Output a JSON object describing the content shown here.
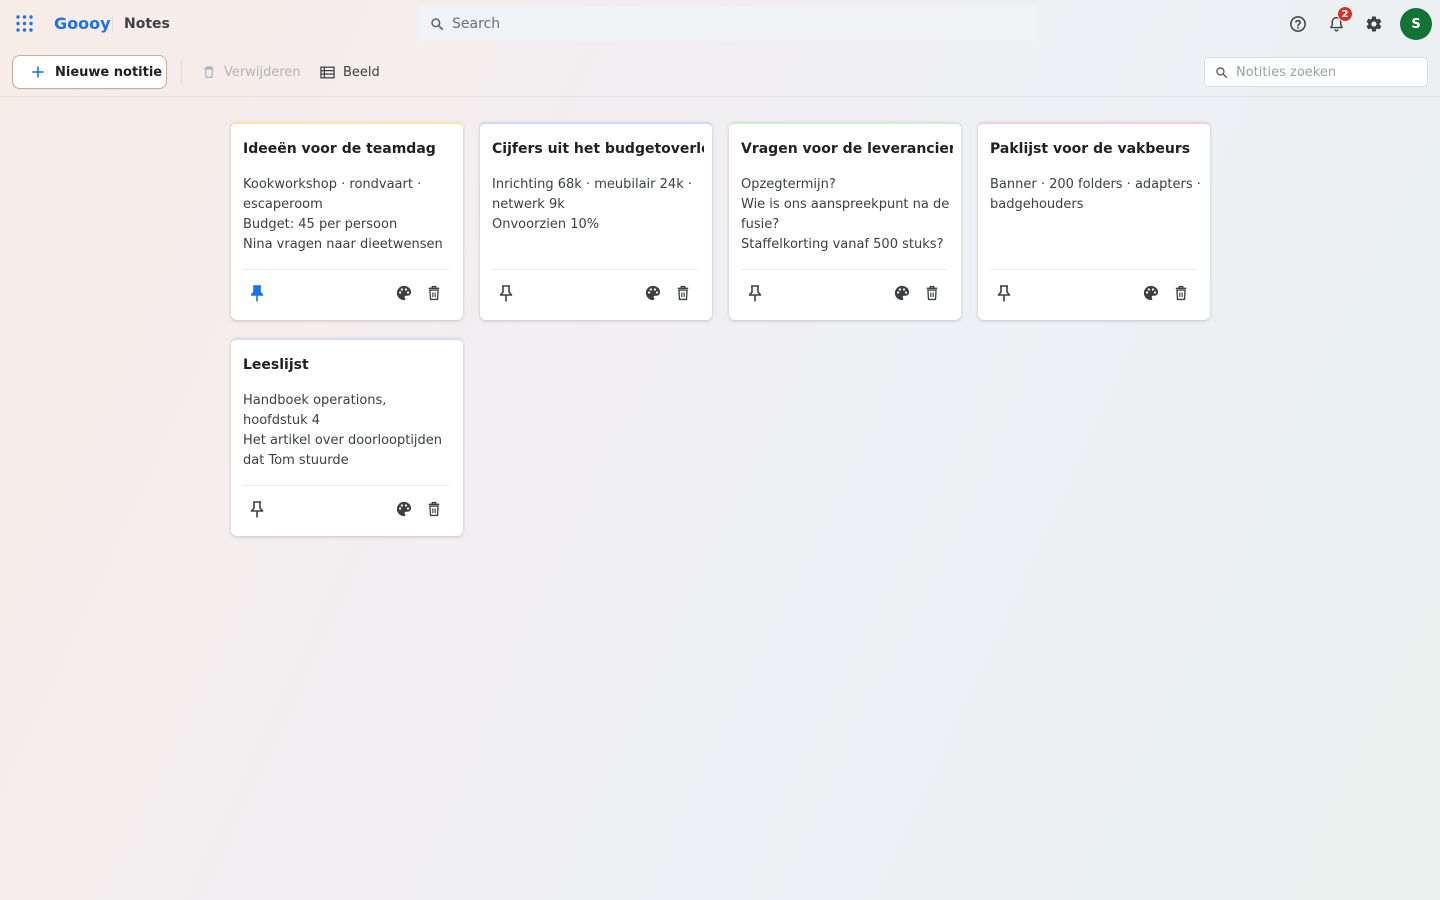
{
  "header": {
    "brand": "Goooy",
    "app_name": "Notes",
    "search_placeholder": "Search",
    "notification_count": "2",
    "avatar_initial": "S"
  },
  "toolbar": {
    "new_note_label": "Nieuwe notitie",
    "delete_label": "Verwijderen",
    "view_label": "Beeld",
    "note_search_placeholder": "Notities zoeken"
  },
  "notes": [
    {
      "title": "Ideeën voor de teamdag",
      "lines": [
        "Kookworkshop · rondvaart · escaperoom",
        "Budget: 45 per persoon",
        "Nina vragen naar dieetwensen"
      ],
      "pinned": true,
      "accent": "#f5e9a8"
    },
    {
      "title": "Cijfers uit het budgetoverleg",
      "lines": [
        "Inrichting 68k · meubilair 24k · netwerk 9k",
        "Onvoorzien 10%"
      ],
      "pinned": false,
      "accent": "#c9dcf7"
    },
    {
      "title": "Vragen voor de leverancier",
      "lines": [
        "Opzegtermijn?",
        "Wie is ons aanspreekpunt na de fusie?",
        "Staffelkorting vanaf 500 stuks?"
      ],
      "pinned": false,
      "accent": "#cdeed3"
    },
    {
      "title": "Paklijst voor de vakbeurs",
      "lines": [
        "Banner · 200 folders · adapters · badgehouders"
      ],
      "pinned": false,
      "accent": "#f6cdd9"
    },
    {
      "title": "Leeslijst",
      "lines": [
        "Handboek operations, hoofdstuk 4",
        "Het artikel over doorlooptijden dat Tom stuurde"
      ],
      "pinned": false,
      "accent": "#e3d6f3"
    }
  ],
  "colors": {
    "brand": "#1a73e8",
    "pin_active": "#1a73e8",
    "avatar_bg": "#137333",
    "badge": "#d93025"
  }
}
